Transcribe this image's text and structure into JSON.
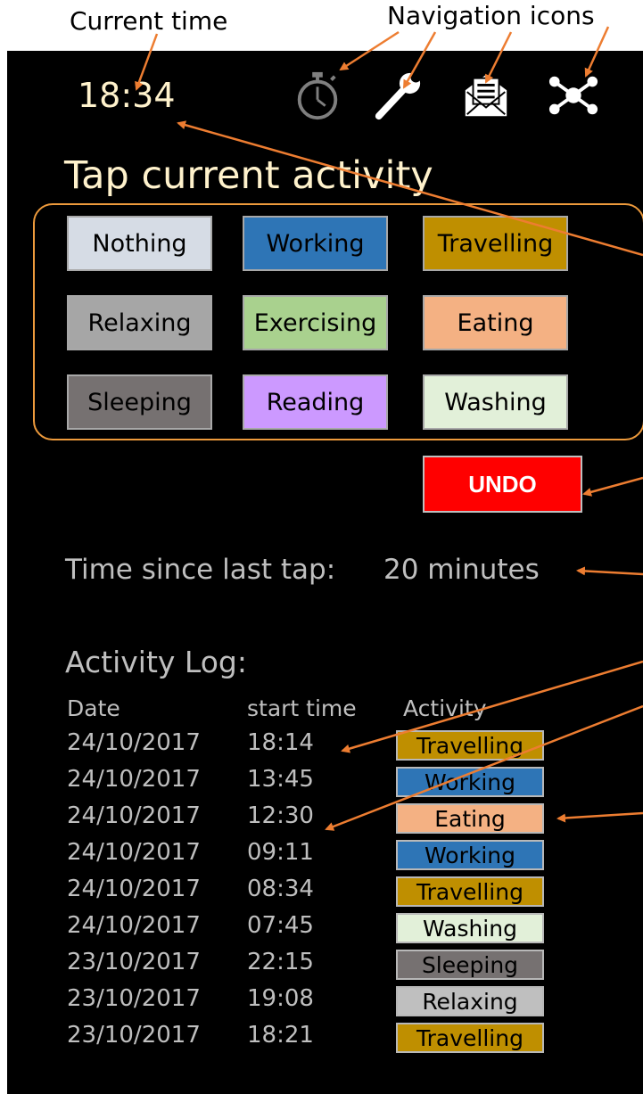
{
  "annotations": {
    "current_time": "Current time",
    "navigation_icons": "Navigation icons"
  },
  "header": {
    "time": "18:34",
    "nav_icons": [
      "stopwatch-icon",
      "wrench-icon",
      "mail-icon",
      "network-icon"
    ]
  },
  "title": "Tap current activity",
  "activities": [
    {
      "label": "Nothing",
      "color": "#d6dce5"
    },
    {
      "label": "Working",
      "color": "#2e75b6"
    },
    {
      "label": "Travelling",
      "color": "#bf8f00"
    },
    {
      "label": "Relaxing",
      "color": "#a6a6a6"
    },
    {
      "label": "Exercising",
      "color": "#a9d18e"
    },
    {
      "label": "Eating",
      "color": "#f4b183"
    },
    {
      "label": "Sleeping",
      "color": "#767171"
    },
    {
      "label": "Reading",
      "color": "#cc99ff"
    },
    {
      "label": "Washing",
      "color": "#e2f0d9"
    }
  ],
  "undo_label": "UNDO",
  "since": {
    "label": "Time since last tap:",
    "value": "20 minutes"
  },
  "log": {
    "title": "Activity Log:",
    "columns": [
      "Date",
      "start time",
      "Activity"
    ],
    "rows": [
      {
        "date": "24/10/2017",
        "time": "18:14",
        "activity": "Travelling",
        "color": "#bf8f00"
      },
      {
        "date": "24/10/2017",
        "time": "13:45",
        "activity": "Working",
        "color": "#2e75b6"
      },
      {
        "date": "24/10/2017",
        "time": "12:30",
        "activity": "Eating",
        "color": "#f4b183"
      },
      {
        "date": "24/10/2017",
        "time": "09:11",
        "activity": "Working",
        "color": "#2e75b6"
      },
      {
        "date": "24/10/2017",
        "time": "08:34",
        "activity": "Travelling",
        "color": "#bf8f00"
      },
      {
        "date": "24/10/2017",
        "time": "07:45",
        "activity": "Washing",
        "color": "#e2f0d9"
      },
      {
        "date": "23/10/2017",
        "time": "22:15",
        "activity": "Sleeping",
        "color": "#767171"
      },
      {
        "date": "23/10/2017",
        "time": "19:08",
        "activity": "Relaxing",
        "color": "#bfbfbf"
      },
      {
        "date": "23/10/2017",
        "time": "18:21",
        "activity": "Travelling",
        "color": "#bf8f00"
      }
    ]
  },
  "colors": {
    "accent": "#ed7d31",
    "title_text": "#fff2cc",
    "undo": "#ff0000"
  }
}
